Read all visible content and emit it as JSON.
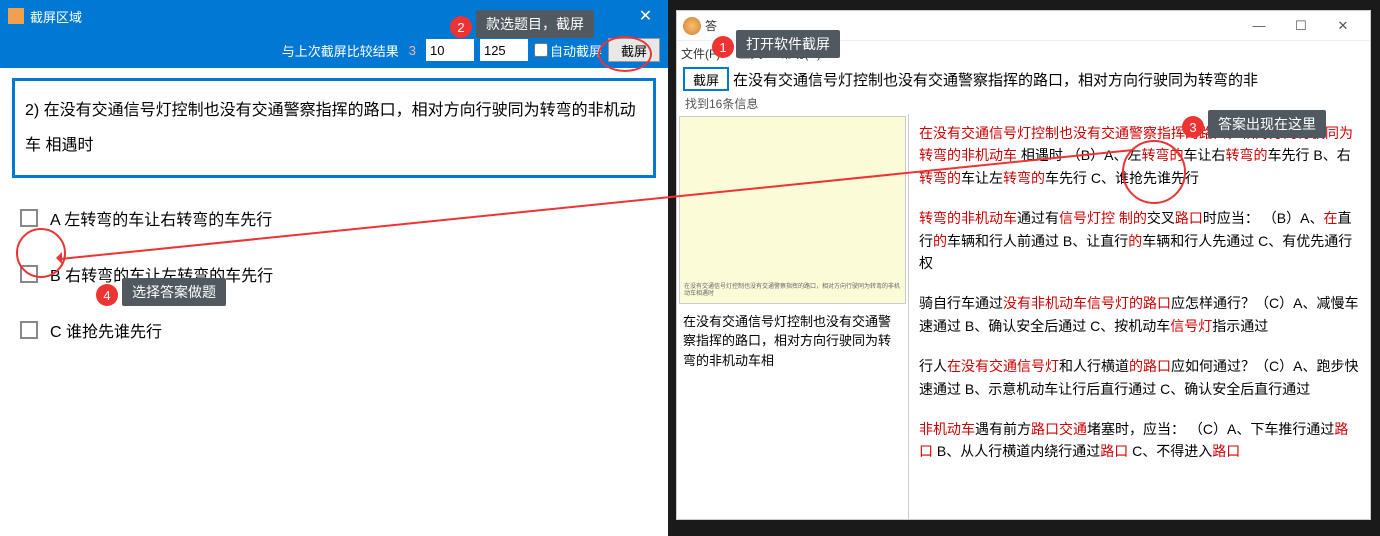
{
  "left": {
    "title": "截屏区域",
    "toolbar": {
      "compare_label": "与上次截屏比较结果",
      "compare_count": "3",
      "num1": "10",
      "num2": "125",
      "auto_label": "自动截屏",
      "screenshot_btn": "截屏"
    },
    "question": "2) 在没有交通信号灯控制也没有交通警察指挥的路口，相对方向行驶同为转弯的非机动车  相遇时",
    "options": {
      "a": "A 左转弯的车让右转弯的车先行",
      "b": "B 右转弯的车让左转弯的车先行",
      "c": "C 谁抢先谁先行"
    }
  },
  "right": {
    "title": "答",
    "menu": {
      "file": "文件(F)",
      "tools": "工具",
      "help": "帮助(H)"
    },
    "sc_btn": "截屏",
    "question_strip": "在没有交通信号灯控制也没有交通警察指挥的路口，相对方向行驶同为转弯的非",
    "status": "找到16条信息",
    "preview_tiny": "在没有交通信号灯控制也没有交通警察指挥的路口，相对方向行驶同为转弯的非机动车相遇时",
    "preview_caption": "在没有交通信号灯控制也没有交通警察指挥的路口，相对方向行驶同为转弯的非机动车相",
    "answers": [
      {
        "segs": [
          {
            "t": "在没有交通信号灯控制也没有交通警察指挥的路口，相对方向行驶同为转弯的非机动车",
            "r": 1
          },
          {
            "t": " 相遇时 （B）A、左",
            "r": 0
          },
          {
            "t": "转弯的",
            "r": 1
          },
          {
            "t": "车让右",
            "r": 0
          },
          {
            "t": "转弯的",
            "r": 1
          },
          {
            "t": "车先行  B、右",
            "r": 0
          },
          {
            "t": "转弯的",
            "r": 1
          },
          {
            "t": "车让左",
            "r": 0
          },
          {
            "t": "转弯的",
            "r": 1
          },
          {
            "t": "车先行  C、谁抢先谁先行",
            "r": 0
          }
        ]
      },
      {
        "segs": [
          {
            "t": "转弯的非机动车",
            "r": 1
          },
          {
            "t": "通过有",
            "r": 0
          },
          {
            "t": "信号灯控  制的",
            "r": 1
          },
          {
            "t": "交叉",
            "r": 0
          },
          {
            "t": "路口",
            "r": 1
          },
          {
            "t": "时应当： （B）A、",
            "r": 0
          },
          {
            "t": "在",
            "r": 1
          },
          {
            "t": "直行",
            "r": 0
          },
          {
            "t": "的",
            "r": 1
          },
          {
            "t": "车辆和行人前通过  B、让直行",
            "r": 0
          },
          {
            "t": "的",
            "r": 1
          },
          {
            "t": "车辆和行人先通过  C、有优先通行权",
            "r": 0
          }
        ]
      },
      {
        "segs": [
          {
            "t": "骑自行车通过",
            "r": 0
          },
          {
            "t": "没有非机动车信号灯的路口",
            "r": 1
          },
          {
            "t": "应怎样通行？（C）A、减慢车速通过  B、确认安全后通过  C、按机动车",
            "r": 0
          },
          {
            "t": "信号灯",
            "r": 1
          },
          {
            "t": "指示通过",
            "r": 0
          }
        ]
      },
      {
        "segs": [
          {
            "t": "行人",
            "r": 0
          },
          {
            "t": "在没有交通信号灯",
            "r": 1
          },
          {
            "t": "和人行横道",
            "r": 0
          },
          {
            "t": "的路口",
            "r": 1
          },
          {
            "t": "应如何通过？（C）A、跑步快速通过  B、示意机动车让行后直行通过  C、确认安全后直行通过",
            "r": 0
          }
        ]
      },
      {
        "segs": [
          {
            "t": "非机动车",
            "r": 1
          },
          {
            "t": "遇有前方",
            "r": 0
          },
          {
            "t": "路口交通",
            "r": 1
          },
          {
            "t": "堵塞时，应当： （C）A、下车推行通过",
            "r": 0
          },
          {
            "t": "路口",
            "r": 1
          },
          {
            "t": "  B、从人行横道内绕行通过",
            "r": 0
          },
          {
            "t": "路口",
            "r": 1
          },
          {
            "t": "  C、不得进入",
            "r": 0
          },
          {
            "t": "路口",
            "r": 1
          }
        ]
      }
    ]
  },
  "annotations": {
    "c1": "打开软件截屏",
    "c2": "款选题目，截屏",
    "c3": "答案出现在这里",
    "c4": "选择答案做题"
  }
}
